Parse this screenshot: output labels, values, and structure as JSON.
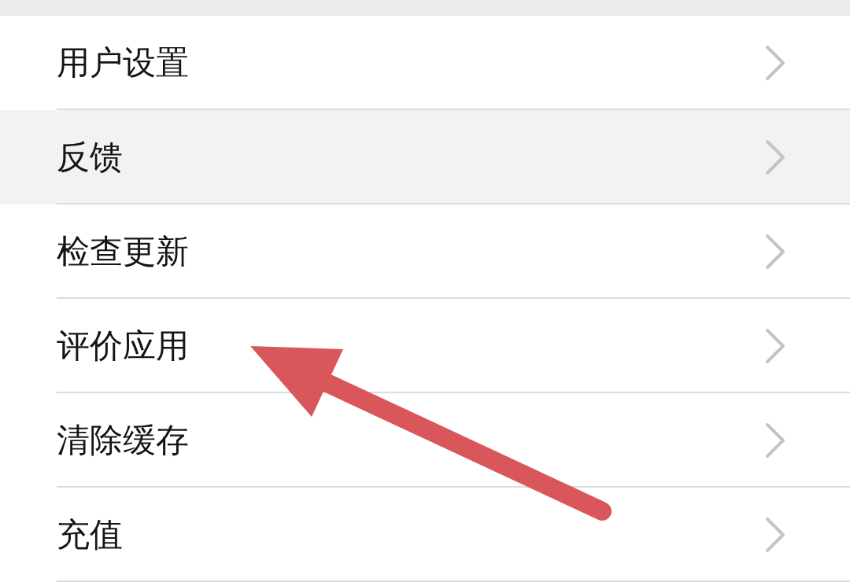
{
  "settings": [
    {
      "label": "用户设置",
      "highlighted": false
    },
    {
      "label": "反馈",
      "highlighted": true
    },
    {
      "label": "检查更新",
      "highlighted": false
    },
    {
      "label": "评价应用",
      "highlighted": false
    },
    {
      "label": "清除缓存",
      "highlighted": false
    },
    {
      "label": "充值",
      "highlighted": false
    }
  ]
}
